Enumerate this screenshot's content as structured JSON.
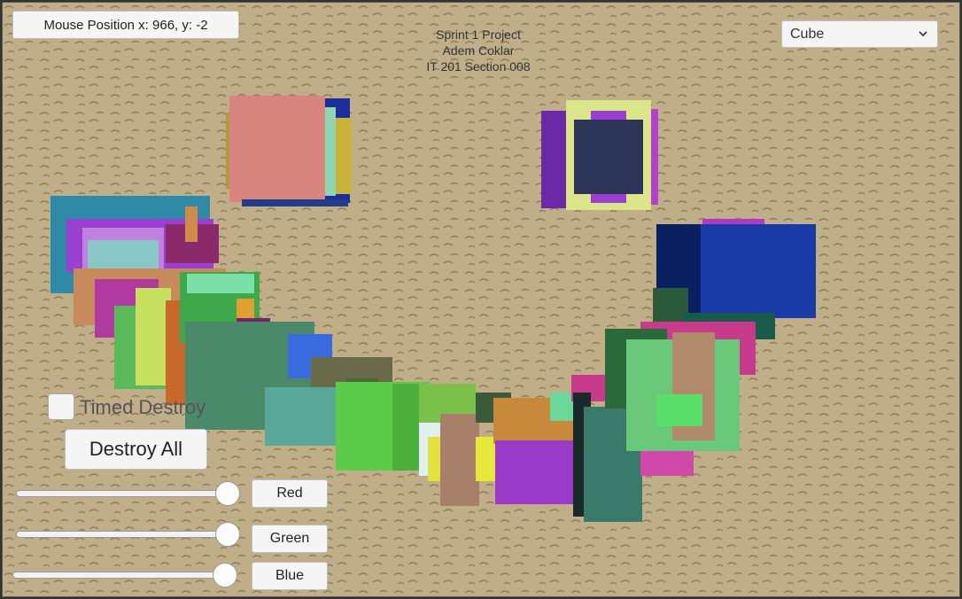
{
  "hud": {
    "mouse_position": "Mouse Position x: 966, y: -2",
    "header_lines": [
      "Sprint 1 Project",
      "Adem Coklar",
      "IT 201 Section 008"
    ],
    "shape_dropdown": {
      "selected": "Cube",
      "icon": "chevron-down-icon"
    },
    "timed_destroy": {
      "label": "Timed Destroy",
      "checked": false
    },
    "destroy_all_label": "Destroy All",
    "sliders": [
      {
        "label": "Red",
        "value": 1.0
      },
      {
        "label": "Green",
        "value": 1.0
      },
      {
        "label": "Blue",
        "value": 1.0
      }
    ]
  },
  "colors": {
    "floor": "#bfae88",
    "ui_background": "#f5f5f5"
  }
}
